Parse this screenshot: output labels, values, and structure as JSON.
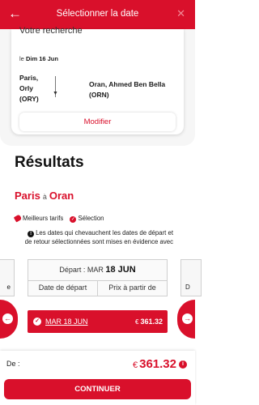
{
  "header": {
    "title": "Sélectionner la date",
    "back_icon": "←",
    "close_icon": "✕"
  },
  "search_card": {
    "heading": "Votre recherche",
    "date_prefix": "le",
    "date": "Dim 16 Jun",
    "origin": "Paris, Orly (ORY)",
    "destination": "Oran, Ahmed Ben Bella (ORN)",
    "modify_label": "Modifier"
  },
  "results": {
    "title": "Résultats",
    "from": "Paris",
    "separator": "à",
    "to": "Oran"
  },
  "legend": {
    "best_price": "Meilleurs tarifs",
    "selection": "Sélection"
  },
  "info_note": "Les dates qui chevauchent les dates de départ et de retour sélectionnées sont mises en évidence avec",
  "grid": {
    "left_stub": "e",
    "right_stub": "D",
    "departure_label": "Départ : MAR",
    "departure_date": "18 JUN",
    "col_date": "Date de départ",
    "col_price": "Prix à partir de"
  },
  "selected_row": {
    "date": "MAR 18 JUN",
    "currency": "€",
    "price": "361.32"
  },
  "footer": {
    "from_label": "De :",
    "currency": "€",
    "total": "361.32",
    "continue_label": "CONTINUER"
  },
  "colors": {
    "brand_red": "#d9102b"
  }
}
